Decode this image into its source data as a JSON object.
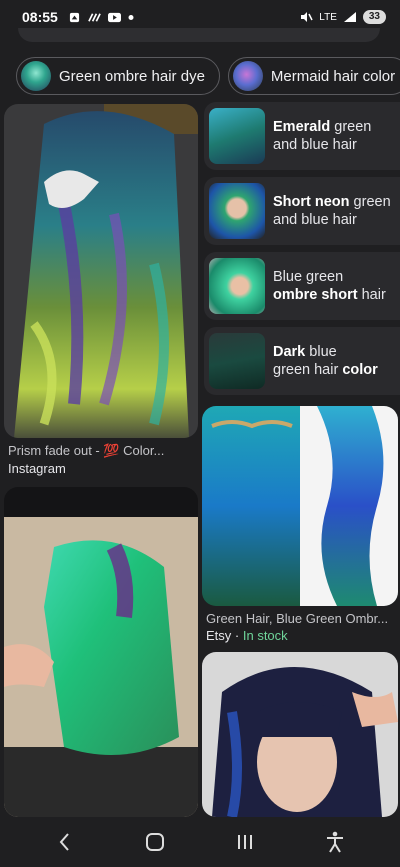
{
  "status": {
    "time": "08:55",
    "signal": "LTE",
    "battery": "33",
    "left_icons": [
      "photos-icon",
      "tidal-icon",
      "youtube-icon",
      "dot-icon"
    ]
  },
  "chips": [
    {
      "label": "Green ombre hair dye"
    },
    {
      "label": "Mermaid hair color"
    }
  ],
  "left_cards": [
    {
      "title": "Prism fade out - 💯 Color...",
      "source": "Instagram"
    },
    {
      "title": "",
      "source": ""
    }
  ],
  "related": [
    {
      "bold": "Emerald",
      "rest1": " green",
      "line2": "and blue hair"
    },
    {
      "bold": "Short neon",
      "rest1": " green",
      "line2": "and blue hair"
    },
    {
      "pre": "Blue green",
      "bold2": "ombre short",
      "rest2": " hair"
    },
    {
      "bold": "Dark",
      "rest1": " blue",
      "line2a": "green hair ",
      "bold2": "color"
    }
  ],
  "right_cards": [
    {
      "title": "Green Hair, Blue Green Ombr...",
      "source": "Etsy",
      "stock": "In stock"
    },
    {
      "title": "",
      "source": ""
    }
  ],
  "colors": {
    "background": "#1f1f21",
    "stock": "#6fd49a"
  }
}
